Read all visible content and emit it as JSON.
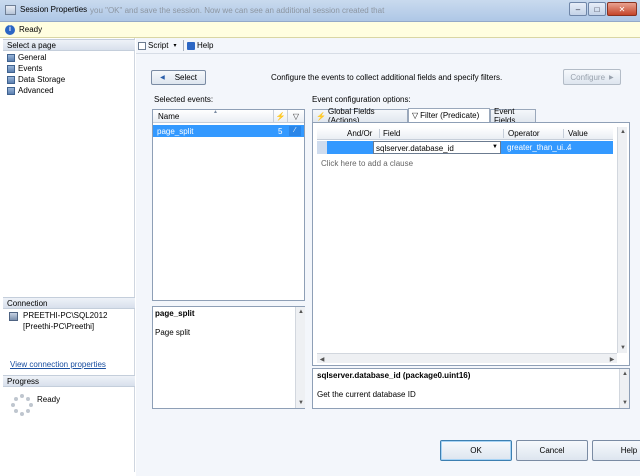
{
  "window": {
    "title": "Session Properties",
    "background_hint": "you \"OK\" and save the session. Now we can see an additional session created that",
    "minimize_glyph": "–",
    "maximize_glyph": "□",
    "close_glyph": "✕"
  },
  "status": {
    "text": "Ready"
  },
  "left": {
    "select_page_header": "Select a page",
    "pages": [
      "General",
      "Events",
      "Data Storage",
      "Advanced"
    ],
    "connection_header": "Connection",
    "server": "PREETHI-PC\\SQL2012",
    "user": "[Preethi-PC\\Preethi]",
    "view_connection_link": "View connection properties",
    "progress_header": "Progress",
    "progress_status": "Ready"
  },
  "toolbar": {
    "script_label": "Script",
    "help_label": "Help"
  },
  "events": {
    "select_button": "Select",
    "description": "Configure the events to collect additional fields and specify filters.",
    "configure_button": "Configure",
    "selected_events_label": "Selected events:",
    "name_header": "Name",
    "rows": [
      {
        "name": "page_split",
        "count": "5"
      }
    ],
    "detail_title": "page_split",
    "detail_desc": "Page split"
  },
  "config": {
    "label": "Event configuration options:",
    "tabs": [
      "Global Fields (Actions)",
      "Filter (Predicate)",
      "Event Fields"
    ],
    "active_tab": 1,
    "columns": [
      "And/Or",
      "Field",
      "Operator",
      "Value"
    ],
    "row": {
      "andor": "",
      "field": "sqlserver.database_id",
      "operator": "greater_than_ui...",
      "value": "4"
    },
    "add_clause": "Click here to add a clause",
    "detail_title": "sqlserver.database_id (package0.uint16)",
    "detail_desc": "Get the current database ID"
  },
  "buttons": {
    "ok": "OK",
    "cancel": "Cancel",
    "help": "Help"
  },
  "colors": {
    "selection": "#3399ff",
    "link": "#1a4fa0",
    "status_bg": "#fffee0"
  }
}
